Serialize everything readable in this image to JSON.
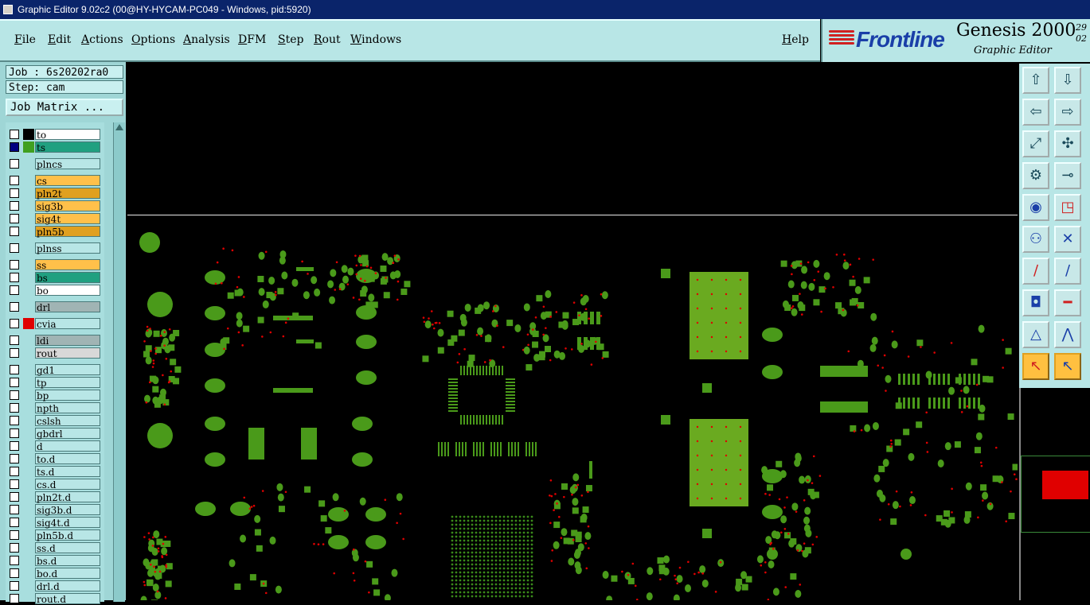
{
  "window": {
    "title": "Graphic Editor 9.02c2 (00@HY-HYCAM-PC049 - Windows, pid:5920)"
  },
  "menu": {
    "items": [
      "File",
      "Edit",
      "Actions",
      "Options",
      "Analysis",
      "DFM",
      "Step",
      "Rout",
      "Windows"
    ],
    "help": "Help"
  },
  "brand": {
    "logo": "Frontline",
    "product": "Genesis 2000",
    "subtitle": "Graphic Editor",
    "date_line1": "29",
    "date_line2": "02"
  },
  "job": {
    "job_label": "Job : 6s20202ra0",
    "step_label": "Step: cam",
    "matrix_button": "Job Matrix ..."
  },
  "colors": {
    "board_fill": "#4a9a1a",
    "board_pad": "#6aaa20",
    "drill_red": "#e00000",
    "orange": "#ffc04a",
    "teal": "#20a080",
    "gray": "#b0c4c4",
    "white": "#ffffff"
  },
  "layers": [
    {
      "name": "to",
      "color": "#ffffff",
      "swatch": "#000000"
    },
    {
      "name": "ts",
      "color": "#20a080",
      "swatch": "#40a020",
      "active": true
    },
    {
      "name": "plncs",
      "color": "#b8e6e6",
      "swatch": ""
    },
    {
      "name": "cs",
      "color": "#ffc04a",
      "swatch": ""
    },
    {
      "name": "pln2t",
      "color": "#e0a020",
      "swatch": ""
    },
    {
      "name": "sig3b",
      "color": "#ffc04a",
      "swatch": ""
    },
    {
      "name": "sig4t",
      "color": "#ffc04a",
      "swatch": ""
    },
    {
      "name": "pln5b",
      "color": "#e0a020",
      "swatch": ""
    },
    {
      "name": "plnss",
      "color": "#b8e6e6",
      "swatch": ""
    },
    {
      "name": "ss",
      "color": "#ffc04a",
      "swatch": ""
    },
    {
      "name": "bs",
      "color": "#20a080",
      "swatch": ""
    },
    {
      "name": "bo",
      "color": "#ffffff",
      "swatch": ""
    },
    {
      "name": "drl",
      "color": "#a0b4b4",
      "swatch": ""
    },
    {
      "name": "cvia",
      "color": "#b8e6e6",
      "swatch": "#e00000"
    },
    {
      "name": "ldi",
      "color": "#a0b4b4",
      "swatch": ""
    },
    {
      "name": "rout",
      "color": "#d8d8d8",
      "swatch": ""
    },
    {
      "name": "gd1",
      "color": "#b8e6e6",
      "swatch": ""
    },
    {
      "name": "tp",
      "color": "#b8e6e6",
      "swatch": ""
    },
    {
      "name": "bp",
      "color": "#b8e6e6",
      "swatch": ""
    },
    {
      "name": "npth",
      "color": "#b8e6e6",
      "swatch": ""
    },
    {
      "name": "cslsh",
      "color": "#b8e6e6",
      "swatch": ""
    },
    {
      "name": "gbdrl",
      "color": "#b8e6e6",
      "swatch": ""
    },
    {
      "name": "d",
      "color": "#b8e6e6",
      "swatch": ""
    },
    {
      "name": "to.d",
      "color": "#b8e6e6",
      "swatch": ""
    },
    {
      "name": "ts.d",
      "color": "#b8e6e6",
      "swatch": ""
    },
    {
      "name": "cs.d",
      "color": "#b8e6e6",
      "swatch": ""
    },
    {
      "name": "pln2t.d",
      "color": "#b8e6e6",
      "swatch": ""
    },
    {
      "name": "sig3b.d",
      "color": "#b8e6e6",
      "swatch": ""
    },
    {
      "name": "sig4t.d",
      "color": "#b8e6e6",
      "swatch": ""
    },
    {
      "name": "pln5b.d",
      "color": "#b8e6e6",
      "swatch": ""
    },
    {
      "name": "ss.d",
      "color": "#b8e6e6",
      "swatch": ""
    },
    {
      "name": "bs.d",
      "color": "#b8e6e6",
      "swatch": ""
    },
    {
      "name": "bo.d",
      "color": "#b8e6e6",
      "swatch": ""
    },
    {
      "name": "drl.d",
      "color": "#b8e6e6",
      "swatch": ""
    },
    {
      "name": "rout.d",
      "color": "#b8e6e6",
      "swatch": ""
    }
  ],
  "tools": [
    {
      "name": "pan-up-icon"
    },
    {
      "name": "pan-down-icon"
    },
    {
      "name": "pan-left-icon"
    },
    {
      "name": "pan-right-icon"
    },
    {
      "name": "zoom-out-icon"
    },
    {
      "name": "zoom-in-icon"
    },
    {
      "name": "settings-icon"
    },
    {
      "name": "measure-icon"
    },
    {
      "name": "snap-icon"
    },
    {
      "name": "select-box-icon"
    },
    {
      "name": "net-icon"
    },
    {
      "name": "delete-icon"
    },
    {
      "name": "line-icon"
    },
    {
      "name": "line2-icon"
    },
    {
      "name": "pad-icon"
    },
    {
      "name": "slot-icon"
    },
    {
      "name": "triangle-icon"
    },
    {
      "name": "arc-icon"
    },
    {
      "name": "pointer-icon",
      "selected": true
    },
    {
      "name": "pointer-box-icon",
      "selected": true
    }
  ]
}
